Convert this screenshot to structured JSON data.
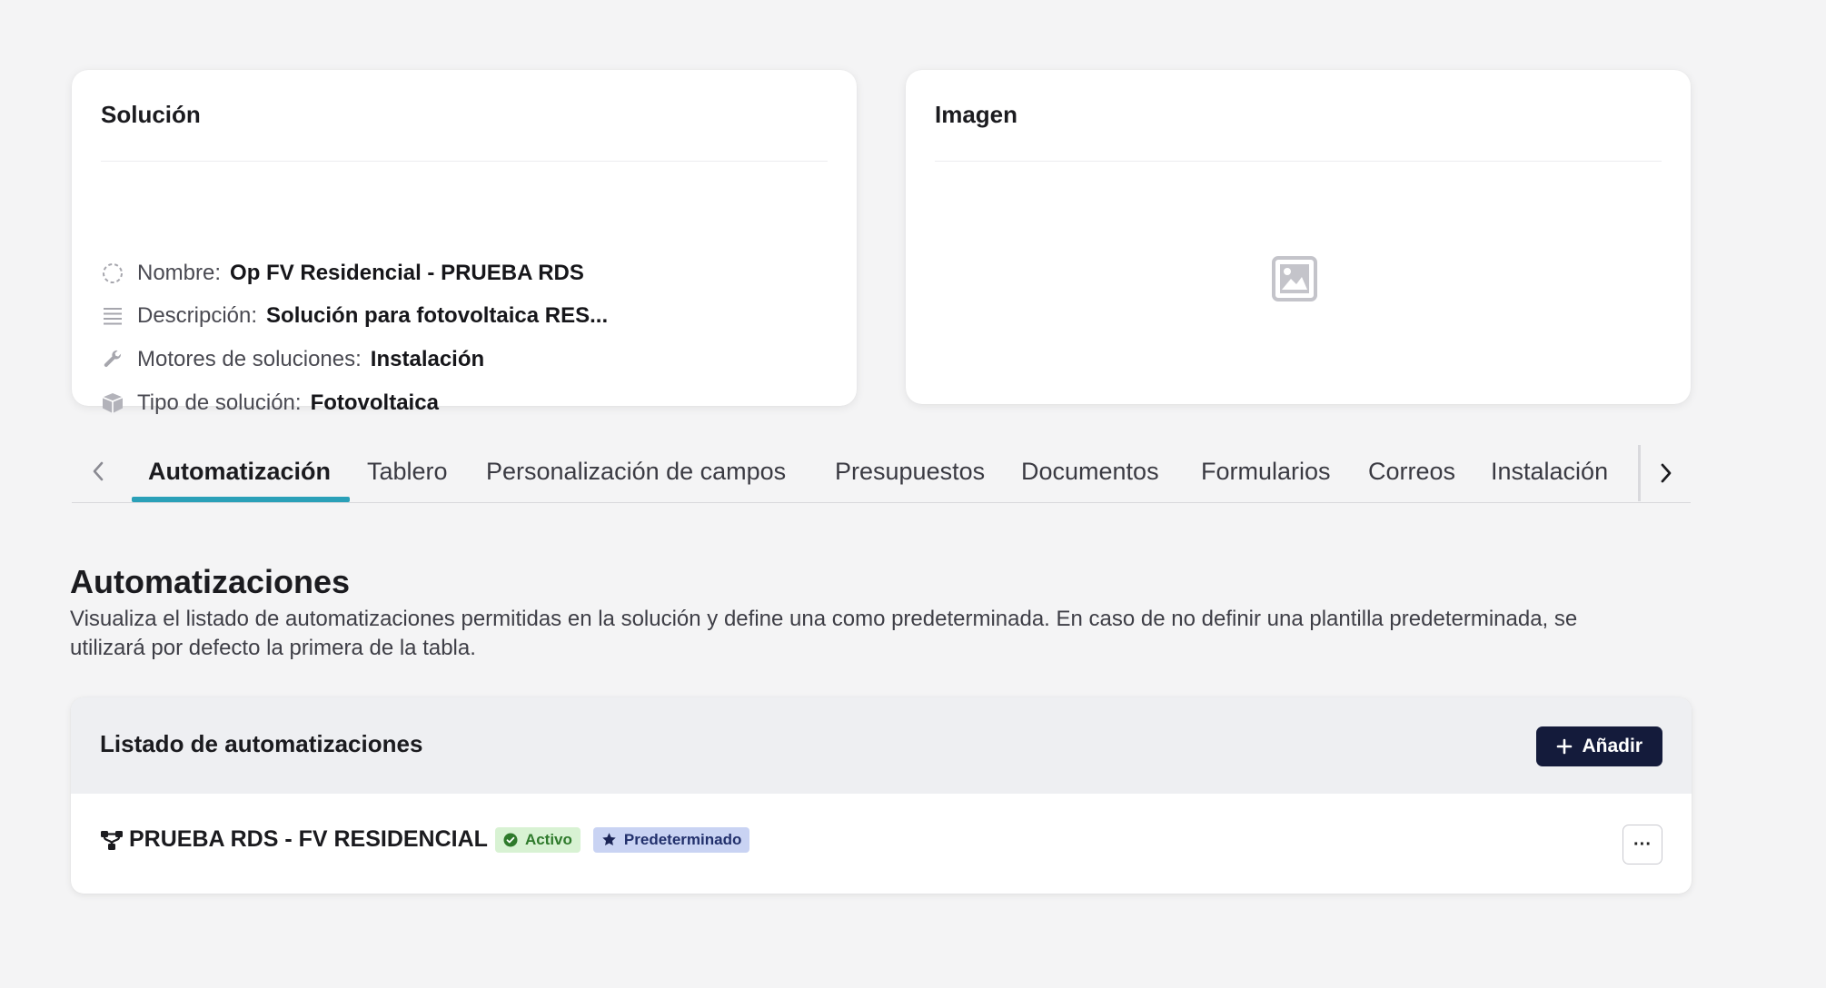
{
  "solution": {
    "title": "Solución",
    "rows": [
      {
        "label": "Nombre:",
        "value": "Op FV Residencial - PRUEBA RDS",
        "icon": "dashed-circle-icon"
      },
      {
        "label": "Descripción:",
        "value": "Solución para fotovoltaica RES...",
        "icon": "lines-icon"
      },
      {
        "label": "Motores de soluciones:",
        "value": "Instalación",
        "icon": "wrench-icon"
      },
      {
        "label": "Tipo de solución:",
        "value": "Fotovoltaica",
        "icon": "box-icon"
      }
    ]
  },
  "image_card": {
    "title": "Imagen",
    "placeholder_icon": "image-placeholder-icon"
  },
  "tabs": {
    "items": [
      "Automatización",
      "Tablero",
      "Personalización de campos",
      "Presupuestos",
      "Documentos",
      "Formularios",
      "Correos",
      "Instalación"
    ],
    "active": "Automatización",
    "accent_color": "#2aa0b8"
  },
  "section": {
    "title": "Automatizaciones",
    "description": "Visualiza el listado de automatizaciones permitidas en la solución y define una como predeterminada. En caso de no definir una plantilla predeterminada, se utilizará por defecto la primera de la tabla."
  },
  "list": {
    "title": "Listado de automatizaciones",
    "add_label": "Añadir",
    "add_button_color": "#141b3b",
    "rows": [
      {
        "name": "PRUEBA RDS - FV RESIDENCIAL",
        "status": "Activo",
        "tag": "Predeterminado",
        "more_label": "···"
      }
    ]
  }
}
